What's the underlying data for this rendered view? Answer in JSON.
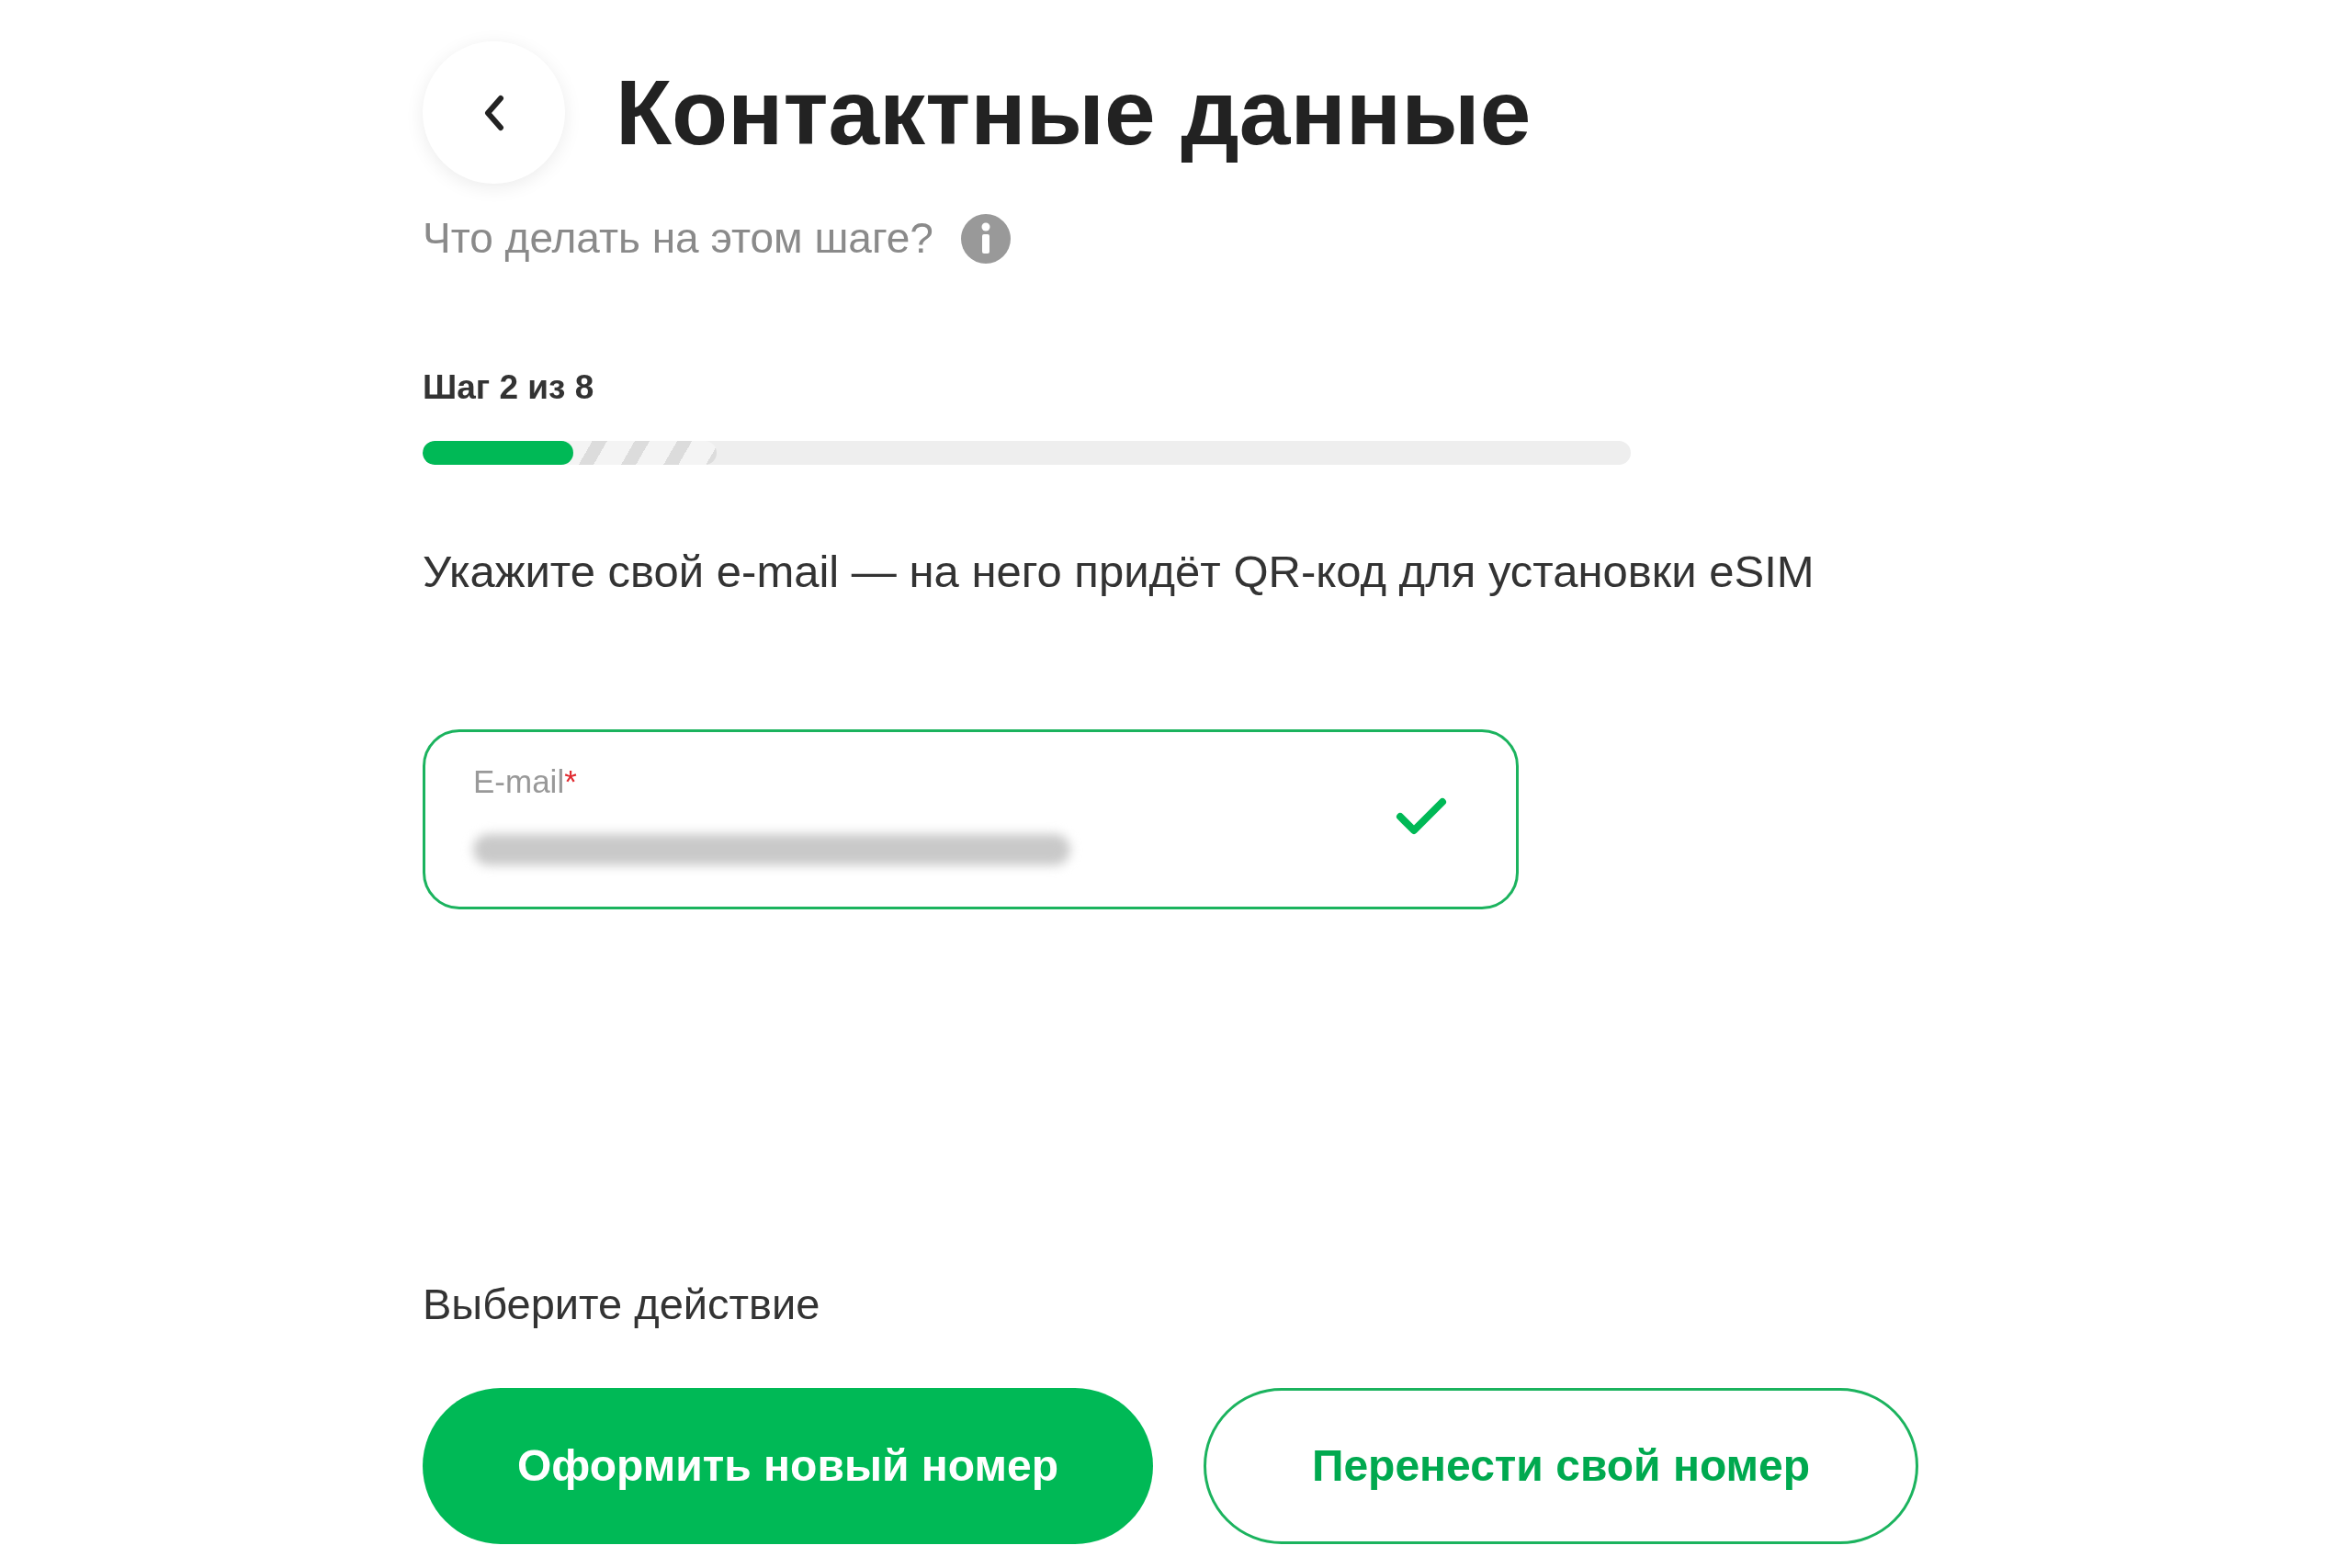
{
  "header": {
    "title": "Контактные данные"
  },
  "help": {
    "text": "Что делать на этом шаге?"
  },
  "progress": {
    "label": "Шаг 2 из 8",
    "level": 0.125
  },
  "instruction": "Укажите свой e-mail — на него придёт QR-код для установки eSIM",
  "email_field": {
    "label": "E-mail",
    "required_mark": "*",
    "valid": true
  },
  "actions": {
    "heading": "Выберите действие",
    "buttons": [
      {
        "label": "Оформить новый номер",
        "kind": "primary"
      },
      {
        "label": "Перенести свой номер",
        "kind": "secondary"
      }
    ]
  }
}
